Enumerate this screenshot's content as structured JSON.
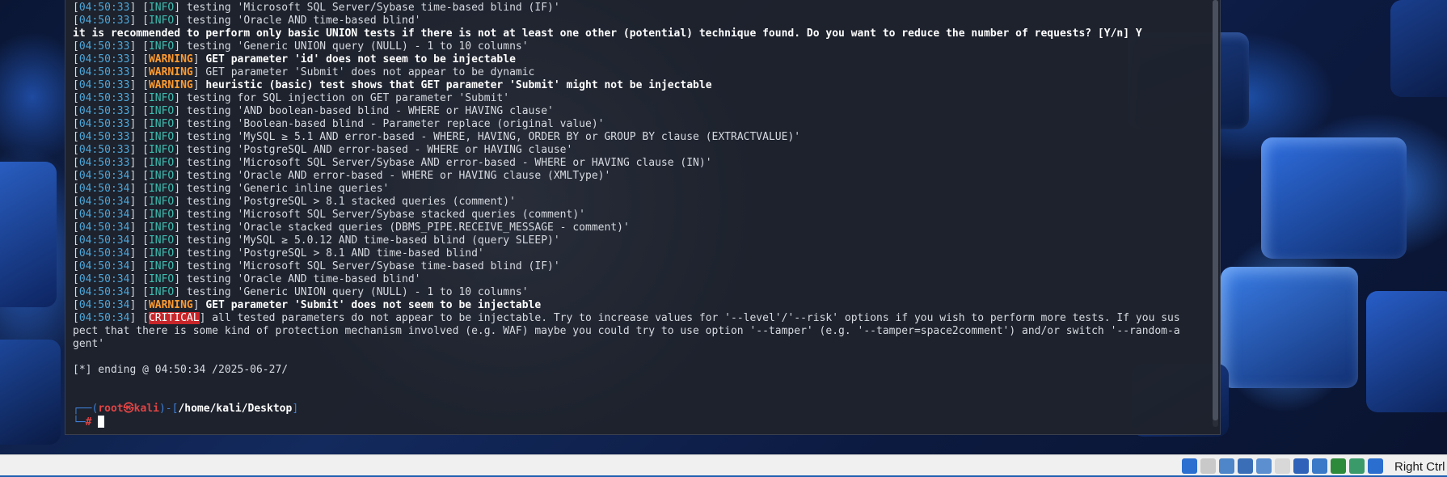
{
  "colors": {
    "timestamp": "#4fa6d8",
    "info": "#3dbdb0",
    "warning": "#ff9b2f",
    "critical_bg": "#c8262a",
    "prompt_root": "#e04444",
    "prompt_frame": "#3f7fd6",
    "terminal_bg": "#1e222c"
  },
  "terminal": {
    "lines": [
      {
        "ts": "04:50:33",
        "level": "INFO",
        "msg": "testing 'Microsoft SQL Server/Sybase time-based blind (IF)'"
      },
      {
        "ts": "04:50:33",
        "level": "INFO",
        "msg": "testing 'Oracle AND time-based blind'"
      },
      {
        "plain_bold": "it is recommended to perform only basic UNION tests if there is not at least one other (potential) technique found. Do you want to reduce the number of requests? [Y/n] Y"
      },
      {
        "ts": "04:50:33",
        "level": "INFO",
        "msg": "testing 'Generic UNION query (NULL) - 1 to 10 columns'"
      },
      {
        "ts": "04:50:33",
        "level": "WARNING",
        "msg": "GET parameter 'id' does not seem to be injectable",
        "bold": true
      },
      {
        "ts": "04:50:33",
        "level": "WARNING",
        "msg": "GET parameter 'Submit' does not appear to be dynamic"
      },
      {
        "ts": "04:50:33",
        "level": "WARNING",
        "msg": "heuristic (basic) test shows that GET parameter 'Submit' might not be injectable",
        "bold": true
      },
      {
        "ts": "04:50:33",
        "level": "INFO",
        "msg": "testing for SQL injection on GET parameter 'Submit'"
      },
      {
        "ts": "04:50:33",
        "level": "INFO",
        "msg": "testing 'AND boolean-based blind - WHERE or HAVING clause'"
      },
      {
        "ts": "04:50:33",
        "level": "INFO",
        "msg": "testing 'Boolean-based blind - Parameter replace (original value)'"
      },
      {
        "ts": "04:50:33",
        "level": "INFO",
        "msg": "testing 'MySQL ≥ 5.1 AND error-based - WHERE, HAVING, ORDER BY or GROUP BY clause (EXTRACTVALUE)'"
      },
      {
        "ts": "04:50:33",
        "level": "INFO",
        "msg": "testing 'PostgreSQL AND error-based - WHERE or HAVING clause'"
      },
      {
        "ts": "04:50:33",
        "level": "INFO",
        "msg": "testing 'Microsoft SQL Server/Sybase AND error-based - WHERE or HAVING clause (IN)'"
      },
      {
        "ts": "04:50:34",
        "level": "INFO",
        "msg": "testing 'Oracle AND error-based - WHERE or HAVING clause (XMLType)'"
      },
      {
        "ts": "04:50:34",
        "level": "INFO",
        "msg": "testing 'Generic inline queries'"
      },
      {
        "ts": "04:50:34",
        "level": "INFO",
        "msg": "testing 'PostgreSQL > 8.1 stacked queries (comment)'"
      },
      {
        "ts": "04:50:34",
        "level": "INFO",
        "msg": "testing 'Microsoft SQL Server/Sybase stacked queries (comment)'"
      },
      {
        "ts": "04:50:34",
        "level": "INFO",
        "msg": "testing 'Oracle stacked queries (DBMS_PIPE.RECEIVE_MESSAGE - comment)'"
      },
      {
        "ts": "04:50:34",
        "level": "INFO",
        "msg": "testing 'MySQL ≥ 5.0.12 AND time-based blind (query SLEEP)'"
      },
      {
        "ts": "04:50:34",
        "level": "INFO",
        "msg": "testing 'PostgreSQL > 8.1 AND time-based blind'"
      },
      {
        "ts": "04:50:34",
        "level": "INFO",
        "msg": "testing 'Microsoft SQL Server/Sybase time-based blind (IF)'"
      },
      {
        "ts": "04:50:34",
        "level": "INFO",
        "msg": "testing 'Oracle AND time-based blind'"
      },
      {
        "ts": "04:50:34",
        "level": "INFO",
        "msg": "testing 'Generic UNION query (NULL) - 1 to 10 columns'"
      },
      {
        "ts": "04:50:34",
        "level": "WARNING",
        "msg": "GET parameter 'Submit' does not seem to be injectable",
        "bold": true
      },
      {
        "ts": "04:50:34",
        "level": "CRITICAL",
        "msg": "all tested parameters do not appear to be injectable. Try to increase values for '--level'/'--risk' options if you wish to perform more tests. If you sus"
      },
      {
        "plain": "pect that there is some kind of protection mechanism involved (e.g. WAF) maybe you could try to use option '--tamper' (e.g. '--tamper=space2comment') and/or switch '--random-a"
      },
      {
        "plain": "gent'"
      },
      {
        "plain": ""
      },
      {
        "plain": "[*] ending @ 04:50:34 /2025-06-27/"
      },
      {
        "plain": ""
      },
      {
        "plain": ""
      }
    ],
    "prompt": {
      "user": "root",
      "symbol": "㉿",
      "host": "kali",
      "path": "/home/kali/Desktop",
      "sign": "#"
    }
  },
  "statusbar": {
    "icons": [
      "harddisk-icon",
      "optical-disk-icon",
      "audio-icon",
      "network-icon",
      "usb-icon",
      "shared-folder-icon",
      "display-icon",
      "recording-icon",
      "cpu-icon",
      "mouse-integration-icon",
      "download-icon"
    ],
    "host_key": "Right Ctrl"
  }
}
